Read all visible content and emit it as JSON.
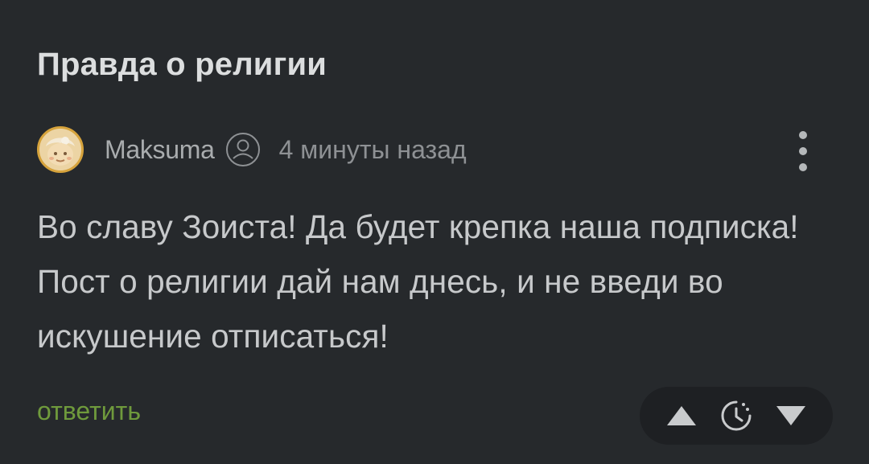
{
  "post": {
    "title": "Правда о религии"
  },
  "comment": {
    "author": "Maksuma",
    "time": "4 минуты назад",
    "text": "Во славу Зоиста! Да будет крепка наша подписка! Пост о религии дай нам днесь, и не введи во искушение отписаться!",
    "reply_label": "ответить"
  },
  "icons": {
    "user_badge": "user-circle-icon",
    "more": "vertical-dots-icon",
    "upvote": "triangle-up-icon",
    "rating_hidden": "clock-icon",
    "downvote": "triangle-down-icon"
  },
  "colors": {
    "background": "#26292c",
    "title": "#dcdedf",
    "reply_accent": "#6f9a3c",
    "vote_pill_bg": "#1e2023"
  }
}
